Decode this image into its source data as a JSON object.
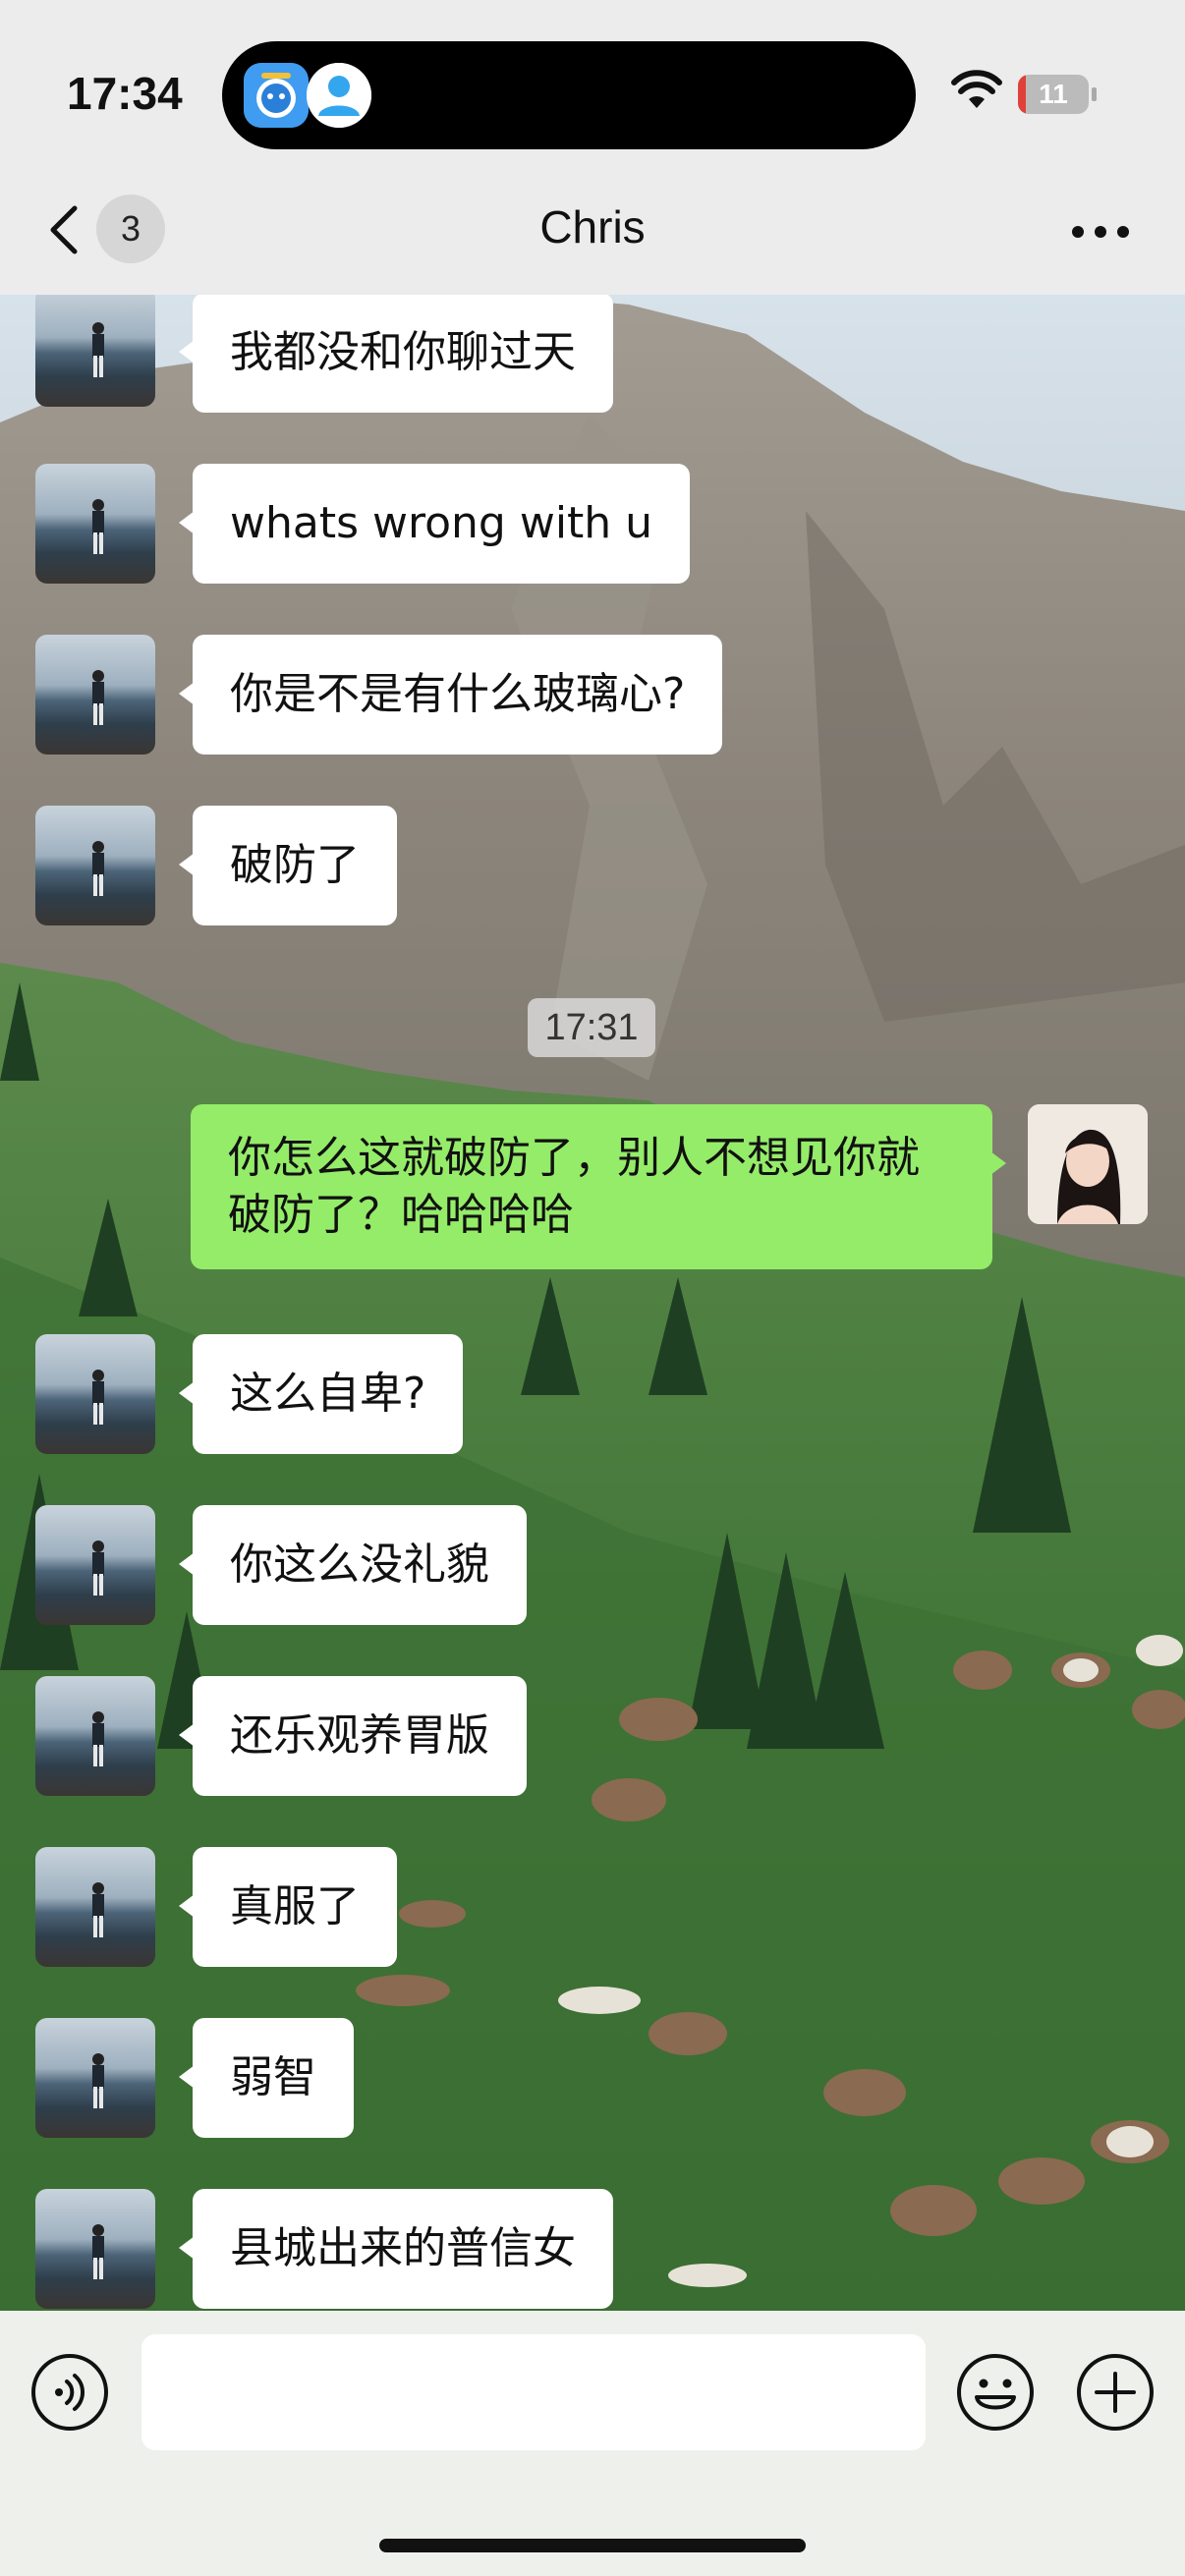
{
  "status_bar": {
    "time": "17:34",
    "battery_level": "11",
    "battery_fraction": 0.11,
    "icons": [
      "app-avatar-icon",
      "contact-person-icon",
      "wifi-icon",
      "battery-icon"
    ]
  },
  "nav": {
    "title": "Chris",
    "back_badge": "3",
    "icons": [
      "chevron-left-icon",
      "more-icon"
    ]
  },
  "messages": [
    {
      "side": "left",
      "text": "我都没和你聊过天"
    },
    {
      "side": "left",
      "text": "whats wrong with u"
    },
    {
      "side": "left",
      "text": "你是不是有什么玻璃心?"
    },
    {
      "side": "left",
      "text": "破防了"
    },
    {
      "side": "right",
      "text": "你怎么这就破防了，别人不想见你就破防了？哈哈哈哈"
    },
    {
      "side": "left",
      "text": "这么自卑?"
    },
    {
      "side": "left",
      "text": "你这么没礼貌"
    },
    {
      "side": "left",
      "text": "还乐观养胃版"
    },
    {
      "side": "left",
      "text": "真服了"
    },
    {
      "side": "left",
      "text": "弱智"
    },
    {
      "side": "left",
      "text": "县城出来的普信女"
    }
  ],
  "timestamp": "17:31",
  "input": {
    "value": "",
    "icons": [
      "voice-icon",
      "emoji-icon",
      "plus-icon"
    ]
  },
  "colors": {
    "outgoing_bubble": "#95ec69",
    "incoming_bubble": "#ffffff",
    "bar_background": "#ececec"
  }
}
